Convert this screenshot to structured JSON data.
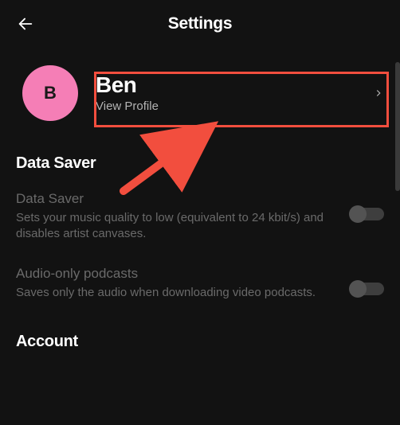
{
  "header": {
    "title": "Settings"
  },
  "profile": {
    "avatar_initial": "B",
    "name": "Ben",
    "subtitle": "View Profile"
  },
  "sections": {
    "data_saver": {
      "title": "Data Saver",
      "items": [
        {
          "label": "Data Saver",
          "desc": "Sets your music quality to low (equivalent to 24 kbit/s) and disables artist canvases."
        },
        {
          "label": "Audio-only podcasts",
          "desc": "Saves only the audio when downloading video podcasts."
        }
      ]
    },
    "account": {
      "title": "Account"
    }
  },
  "colors": {
    "highlight": "#f24e3e",
    "avatar_bg": "#f57eb6"
  }
}
